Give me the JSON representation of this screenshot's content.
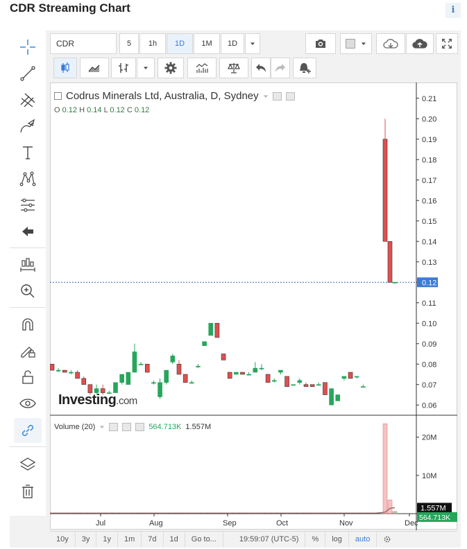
{
  "page": {
    "title": "CDR Streaming Chart",
    "info_glyph": "i"
  },
  "toolbar": {
    "symbol": "CDR",
    "intervals": [
      "5",
      "1h",
      "1D",
      "1M",
      "1D"
    ],
    "selected_interval_index": 2
  },
  "legend": {
    "title": "Codrus Minerals Ltd, Australia, D, Sydney",
    "ohlc": {
      "o_label": "O",
      "o": "0.12",
      "h_label": "H",
      "h": "0.14",
      "l_label": "L",
      "l": "0.12",
      "c_label": "C",
      "c": "0.12"
    }
  },
  "volume_legend": {
    "label": "Volume (20)",
    "value1": "564.713K",
    "value2": "1.557M"
  },
  "watermark": {
    "brand": "Investing",
    "suffix": ".com"
  },
  "price_axis": {
    "ticks": [
      "0.21",
      "0.20",
      "0.19",
      "0.18",
      "0.17",
      "0.16",
      "0.15",
      "0.14",
      "0.13",
      "0.12",
      "0.11",
      "0.10",
      "0.09",
      "0.08",
      "0.07",
      "0.06"
    ],
    "current": "0.12"
  },
  "volume_axis": {
    "ticks": [
      "20M",
      "10M"
    ],
    "tag_black": "1.557M",
    "tag_green": "564.713K"
  },
  "time_axis": {
    "labels": [
      "Jul",
      "Aug",
      "Sep",
      "Oct",
      "Nov",
      "Dec"
    ]
  },
  "bottom_bar": {
    "ranges": [
      "10y",
      "3y",
      "1y",
      "1m",
      "7d",
      "1d"
    ],
    "goto": "Go to...",
    "clock": "19:59:07 (UTC-5)",
    "percent": "%",
    "log": "log",
    "auto": "auto"
  },
  "colors": {
    "up": "#26a65b",
    "down": "#e04f4f",
    "accent": "#3a7bd5"
  },
  "chart_data": {
    "type": "candlestick",
    "title": "Codrus Minerals Ltd, Australia, D, Sydney",
    "ylim": [
      0.055,
      0.215
    ],
    "x_labels": [
      "Jul",
      "Aug",
      "Sep",
      "Oct",
      "Nov",
      "Dec"
    ],
    "candles": [
      {
        "o": 0.08,
        "h": 0.08,
        "l": 0.077,
        "c": 0.077
      },
      {
        "o": 0.077,
        "h": 0.078,
        "l": 0.076,
        "c": 0.077
      },
      {
        "o": 0.077,
        "h": 0.077,
        "l": 0.076,
        "c": 0.076
      },
      {
        "o": 0.076,
        "h": 0.077,
        "l": 0.075,
        "c": 0.076
      },
      {
        "o": 0.076,
        "h": 0.077,
        "l": 0.073,
        "c": 0.073
      },
      {
        "o": 0.073,
        "h": 0.074,
        "l": 0.07,
        "c": 0.07
      },
      {
        "o": 0.07,
        "h": 0.07,
        "l": 0.065,
        "c": 0.066
      },
      {
        "o": 0.066,
        "h": 0.07,
        "l": 0.065,
        "c": 0.068
      },
      {
        "o": 0.068,
        "h": 0.07,
        "l": 0.065,
        "c": 0.066
      },
      {
        "o": 0.066,
        "h": 0.067,
        "l": 0.066,
        "c": 0.066
      },
      {
        "o": 0.066,
        "h": 0.071,
        "l": 0.066,
        "c": 0.071
      },
      {
        "o": 0.071,
        "h": 0.075,
        "l": 0.07,
        "c": 0.075
      },
      {
        "o": 0.07,
        "h": 0.076,
        "l": 0.07,
        "c": 0.076
      },
      {
        "o": 0.076,
        "h": 0.09,
        "l": 0.076,
        "c": 0.086
      },
      {
        "o": 0.08,
        "h": 0.081,
        "l": 0.08,
        "c": 0.08
      },
      {
        "o": 0.08,
        "h": 0.08,
        "l": 0.076,
        "c": 0.076
      },
      {
        "o": 0.071,
        "h": 0.072,
        "l": 0.07,
        "c": 0.071
      },
      {
        "o": 0.064,
        "h": 0.073,
        "l": 0.063,
        "c": 0.071
      },
      {
        "o": 0.071,
        "h": 0.077,
        "l": 0.07,
        "c": 0.077
      },
      {
        "o": 0.081,
        "h": 0.085,
        "l": 0.08,
        "c": 0.084
      },
      {
        "o": 0.08,
        "h": 0.082,
        "l": 0.075,
        "c": 0.075
      },
      {
        "o": 0.075,
        "h": 0.075,
        "l": 0.071,
        "c": 0.071
      },
      {
        "o": 0.071,
        "h": 0.072,
        "l": 0.071,
        "c": 0.071
      },
      {
        "o": 0.079,
        "h": 0.08,
        "l": 0.078,
        "c": 0.079
      },
      {
        "o": 0.089,
        "h": 0.091,
        "l": 0.089,
        "c": 0.091
      },
      {
        "o": 0.094,
        "h": 0.1,
        "l": 0.094,
        "c": 0.1
      },
      {
        "o": 0.1,
        "h": 0.1,
        "l": 0.093,
        "c": 0.093
      },
      {
        "o": 0.085,
        "h": 0.085,
        "l": 0.082,
        "c": 0.082
      },
      {
        "o": 0.076,
        "h": 0.076,
        "l": 0.073,
        "c": 0.073
      },
      {
        "o": 0.075,
        "h": 0.076,
        "l": 0.075,
        "c": 0.076
      },
      {
        "o": 0.076,
        "h": 0.076,
        "l": 0.075,
        "c": 0.075
      },
      {
        "o": 0.075,
        "h": 0.076,
        "l": 0.075,
        "c": 0.075
      },
      {
        "o": 0.076,
        "h": 0.081,
        "l": 0.076,
        "c": 0.078
      },
      {
        "o": 0.078,
        "h": 0.08,
        "l": 0.077,
        "c": 0.078
      },
      {
        "o": 0.075,
        "h": 0.075,
        "l": 0.071,
        "c": 0.071
      },
      {
        "o": 0.072,
        "h": 0.073,
        "l": 0.071,
        "c": 0.072
      },
      {
        "o": 0.076,
        "h": 0.077,
        "l": 0.075,
        "c": 0.077
      },
      {
        "o": 0.074,
        "h": 0.074,
        "l": 0.069,
        "c": 0.069
      },
      {
        "o": 0.07,
        "h": 0.07,
        "l": 0.07,
        "c": 0.07
      },
      {
        "o": 0.071,
        "h": 0.073,
        "l": 0.07,
        "c": 0.072
      },
      {
        "o": 0.07,
        "h": 0.071,
        "l": 0.069,
        "c": 0.069
      },
      {
        "o": 0.07,
        "h": 0.07,
        "l": 0.069,
        "c": 0.069
      },
      {
        "o": 0.07,
        "h": 0.071,
        "l": 0.07,
        "c": 0.07
      },
      {
        "o": 0.071,
        "h": 0.071,
        "l": 0.065,
        "c": 0.065
      },
      {
        "o": 0.06,
        "h": 0.068,
        "l": 0.06,
        "c": 0.068
      },
      {
        "o": 0.062,
        "h": 0.065,
        "l": 0.062,
        "c": 0.065
      },
      {
        "o": 0.073,
        "h": 0.074,
        "l": 0.072,
        "c": 0.074
      },
      {
        "o": 0.076,
        "h": 0.076,
        "l": 0.073,
        "c": 0.073
      },
      {
        "o": 0.074,
        "h": 0.074,
        "l": 0.073,
        "c": 0.074
      },
      {
        "o": 0.069,
        "h": 0.07,
        "l": 0.069,
        "c": 0.069
      },
      {
        "o": 0.19,
        "h": 0.2,
        "l": 0.14,
        "c": 0.14
      },
      {
        "o": 0.14,
        "h": 0.14,
        "l": 0.12,
        "c": 0.12
      },
      {
        "o": 0.12,
        "h": 0.12,
        "l": 0.12,
        "c": 0.12
      }
    ],
    "volume_ylim": [
      0,
      25
    ],
    "volume_unit": "M",
    "volume_moving_average": 1.557,
    "volume_last": 0.565
  }
}
